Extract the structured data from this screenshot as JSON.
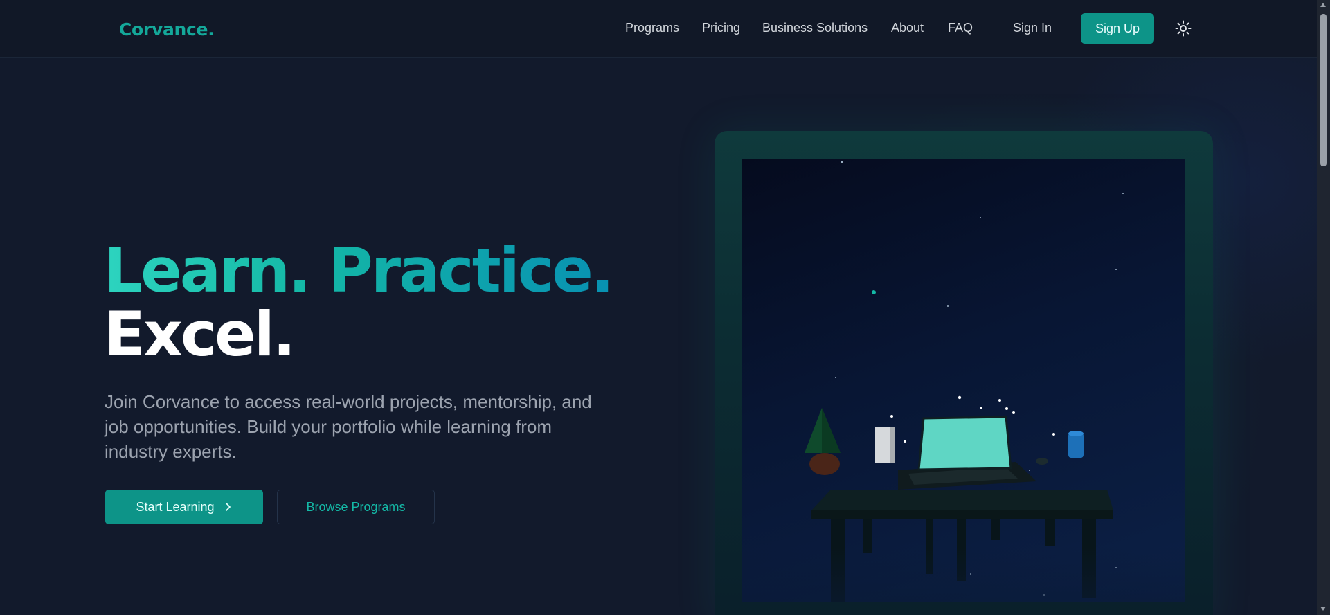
{
  "brand": {
    "logo_text": "Corvance.",
    "accent_color": "#0d9488"
  },
  "nav": {
    "links": [
      {
        "label": "Programs"
      },
      {
        "label": "Pricing"
      },
      {
        "label": "Business Solutions"
      },
      {
        "label": "About"
      },
      {
        "label": "FAQ"
      }
    ],
    "sign_in": "Sign In",
    "sign_up": "Sign Up",
    "theme_toggle_icon": "sun-icon"
  },
  "hero": {
    "headline_line1": "Learn. Practice.",
    "headline_line2": "Excel.",
    "description": "Join Corvance to access real-world projects, mentorship, and job opportunities. Build your portfolio while learning from industry experts.",
    "primary_button": "Start Learning",
    "primary_button_icon": "chevron-right-icon",
    "secondary_button": "Browse Programs"
  },
  "scene": {
    "icon": "desk-scene-illustration"
  }
}
